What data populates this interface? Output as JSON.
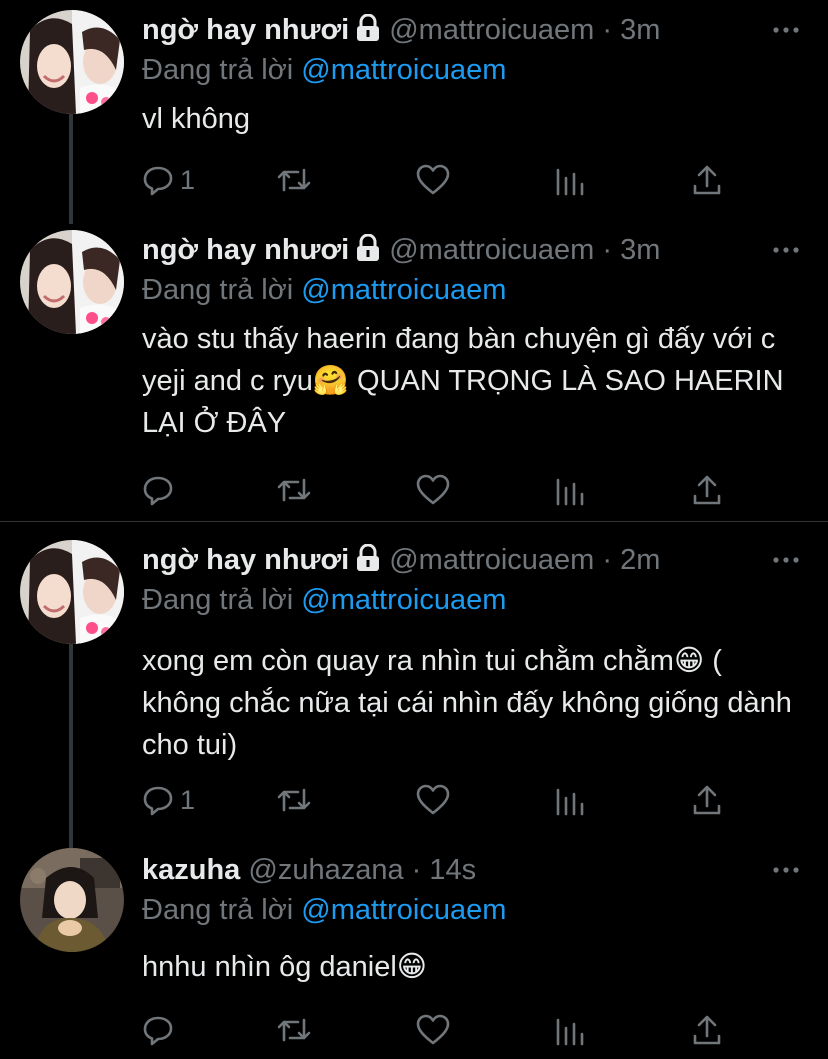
{
  "colors": {
    "background": "#000000",
    "text": "#e7e9ea",
    "muted": "#71767b",
    "mention": "#1d9bf0",
    "divider": "#2f3336"
  },
  "icons": {
    "lock": "lock-icon",
    "more": "more-horizontal-icon",
    "reply": "reply-icon",
    "retweet": "retweet-icon",
    "like": "heart-icon",
    "views": "views-chart-icon",
    "share": "share-icon"
  },
  "tweets": [
    {
      "name": "ngờ hay nhươi",
      "protected": true,
      "handle": "@mattroicuaem",
      "time": "3m",
      "dot": "·",
      "reply_prefix": "Đang trả lời",
      "reply_to": "@mattroicuaem",
      "text": "vl không",
      "reply_count": "1"
    },
    {
      "name": "ngờ hay nhươi",
      "protected": true,
      "handle": "@mattroicuaem",
      "time": "3m",
      "dot": "·",
      "reply_prefix": "Đang trả lời",
      "reply_to": "@mattroicuaem",
      "text": "vào stu thấy haerin đang bàn chuyện gì đấy với c yeji and c ryu🤗  QUAN TRỌNG LÀ SAO HAERIN LẠI Ở ĐÂY",
      "reply_count": ""
    },
    {
      "name": "ngờ hay nhươi",
      "protected": true,
      "handle": "@mattroicuaem",
      "time": "2m",
      "dot": "·",
      "reply_prefix": "Đang trả lời",
      "reply_to": "@mattroicuaem",
      "text": "xong em còn quay ra nhìn tui chằm chằm😁 ( không chắc nữa tại cái nhìn đấy không giống dành cho tui)",
      "reply_count": "1"
    },
    {
      "name": "kazuha",
      "protected": false,
      "handle": "@zuhazana",
      "time": "14s",
      "dot": "·",
      "reply_prefix": "Đang trả lời",
      "reply_to": "@mattroicuaem",
      "text": "hnhu nhìn ôg daniel😁",
      "reply_count": ""
    }
  ]
}
